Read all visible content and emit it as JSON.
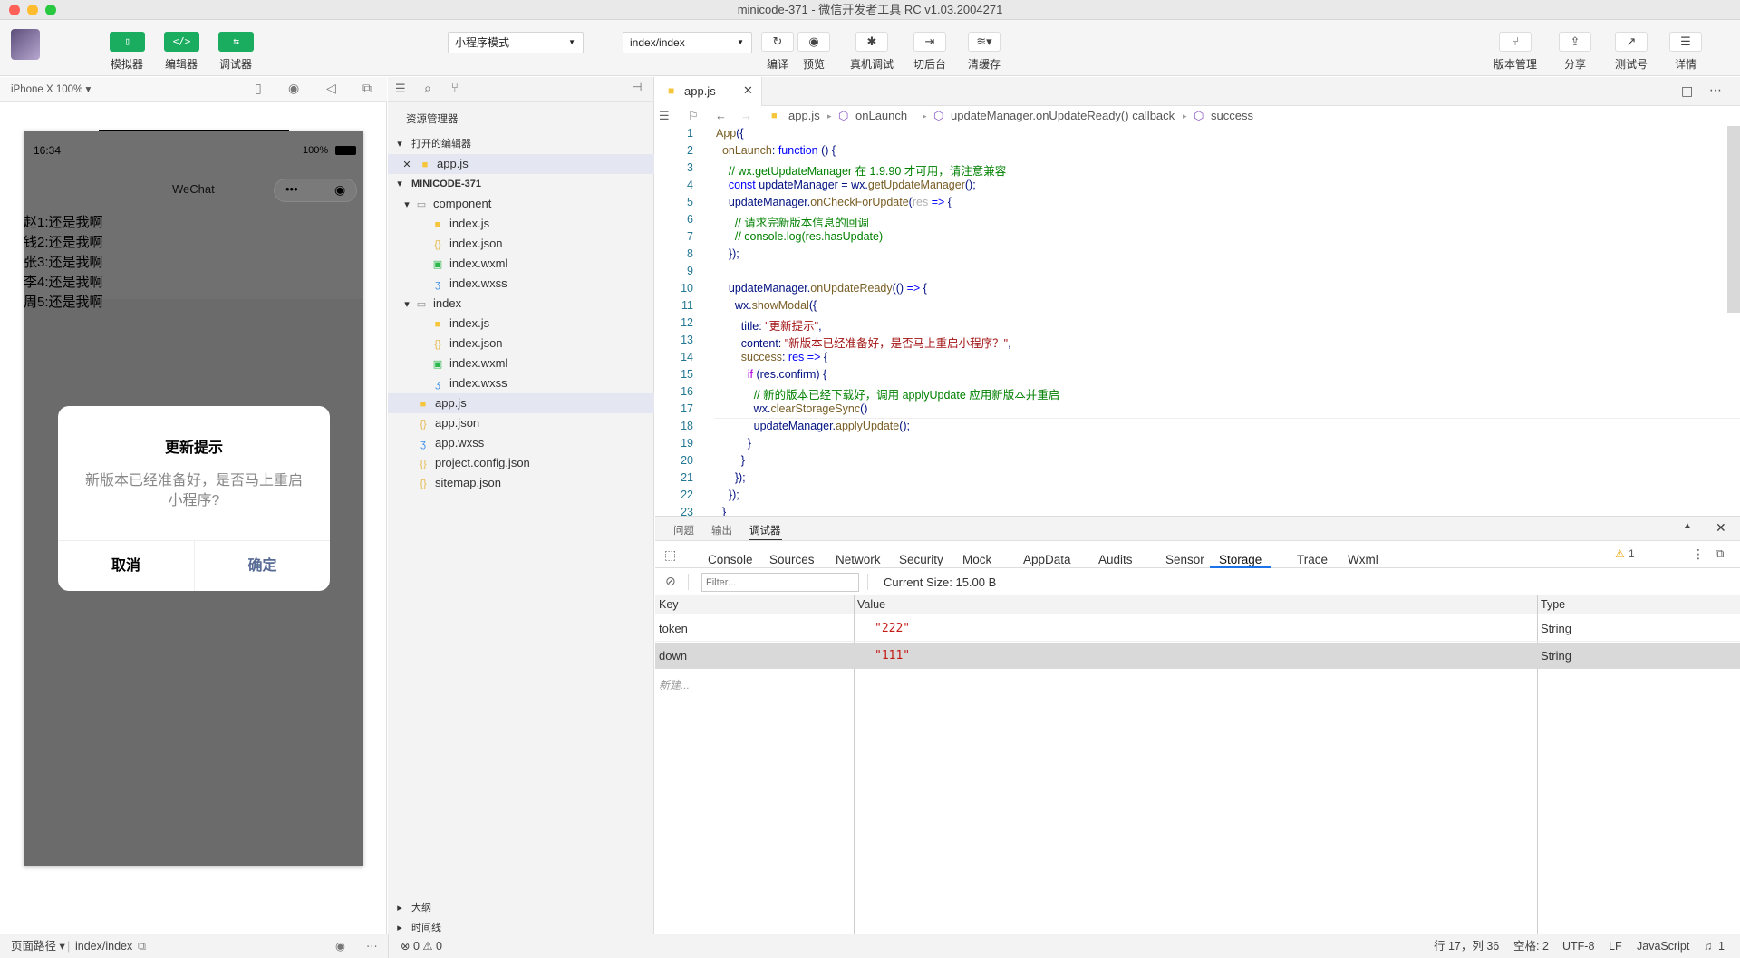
{
  "window": {
    "title": "minicode-371 - 微信开发者工具 RC v1.03.2004271"
  },
  "toolbar": {
    "left": [
      {
        "label": "模拟器",
        "glyph": "▯"
      },
      {
        "label": "编辑器",
        "glyph": "</>"
      },
      {
        "label": "调试器",
        "glyph": "⇆"
      }
    ],
    "mode_select": "小程序模式",
    "page_select": "index/index",
    "actions": [
      {
        "label": "编译",
        "glyph": "↻"
      },
      {
        "label": "预览",
        "glyph": "◉"
      },
      {
        "label": "真机调试",
        "glyph": "✱"
      },
      {
        "label": "切后台",
        "glyph": "⇥"
      },
      {
        "label": "清缓存",
        "glyph": "≋▾"
      }
    ],
    "right": [
      {
        "label": "版本管理",
        "glyph": "⑂"
      },
      {
        "label": "分享",
        "glyph": "⇪"
      },
      {
        "label": "测试号",
        "glyph": "↗"
      },
      {
        "label": "详情",
        "glyph": "☰"
      }
    ]
  },
  "simulator": {
    "device": "iPhone X 100% ▾",
    "status_time": "16:34",
    "battery": "100%",
    "nav_title": "WeChat",
    "list": [
      "赵1:还是我啊",
      "钱2:还是我啊",
      "张3:还是我啊",
      "李4:还是我啊",
      "周5:还是我啊"
    ],
    "modal": {
      "title": "更新提示",
      "content": "新版本已经准备好，是否马上重启小程序?",
      "cancel": "取消",
      "confirm": "确定"
    }
  },
  "explorer": {
    "title": "资源管理器",
    "open_editors": "打开的编辑器",
    "open_file": "app.js",
    "project": "MINICODE-371",
    "tree": [
      {
        "name": "component",
        "type": "folder",
        "depth": 1
      },
      {
        "name": "index.js",
        "type": "js",
        "depth": 2
      },
      {
        "name": "index.json",
        "type": "json",
        "depth": 2
      },
      {
        "name": "index.wxml",
        "type": "wxml",
        "depth": 2
      },
      {
        "name": "index.wxss",
        "type": "wxss",
        "depth": 2
      },
      {
        "name": "index",
        "type": "folder",
        "depth": 1
      },
      {
        "name": "index.js",
        "type": "js",
        "depth": 2
      },
      {
        "name": "index.json",
        "type": "json",
        "depth": 2
      },
      {
        "name": "index.wxml",
        "type": "wxml",
        "depth": 2
      },
      {
        "name": "index.wxss",
        "type": "wxss",
        "depth": 2
      },
      {
        "name": "app.js",
        "type": "js",
        "depth": 1,
        "selected": true
      },
      {
        "name": "app.json",
        "type": "json",
        "depth": 1
      },
      {
        "name": "app.wxss",
        "type": "wxss",
        "depth": 1
      },
      {
        "name": "project.config.json",
        "type": "json",
        "depth": 1
      },
      {
        "name": "sitemap.json",
        "type": "json",
        "depth": 1
      }
    ],
    "outline": "大纲",
    "timeline": "时间线"
  },
  "editor": {
    "tab": "app.js",
    "breadcrumbs": [
      "app.js",
      "onLaunch",
      "updateManager.onUpdateReady() callback",
      "success"
    ],
    "line_numbers": [
      "1",
      "2",
      "3",
      "4",
      "5",
      "6",
      "7",
      "8",
      "9",
      "10",
      "11",
      "12",
      "13",
      "14",
      "15",
      "16",
      "17",
      "18",
      "19",
      "20",
      "21",
      "22",
      "23"
    ]
  },
  "panel": {
    "top_tabs": [
      "问题",
      "输出",
      "调试器"
    ],
    "devtabs": [
      "Console",
      "Sources",
      "Network",
      "Security",
      "Mock",
      "AppData",
      "Audits",
      "Sensor",
      "Storage",
      "Trace",
      "Wxml"
    ],
    "active": "Storage",
    "warn": "1",
    "filter_placeholder": "Filter...",
    "current_size": "Current Size: 15.00 B",
    "columns": [
      "Key",
      "Value",
      "Type"
    ],
    "rows": [
      {
        "key": "token",
        "value": "\"222\"",
        "type": "String"
      },
      {
        "key": "down",
        "value": "\"111\"",
        "type": "String"
      }
    ],
    "new_row": "新建..."
  },
  "status": {
    "page_path_label": "页面路径 ▾",
    "page_path": "index/index",
    "errors": "⊗ 0 ⚠ 0",
    "cursor": "行 17，列 36",
    "spaces": "空格: 2",
    "encoding": "UTF-8",
    "eol": "LF",
    "language": "JavaScript",
    "bell": "1"
  }
}
